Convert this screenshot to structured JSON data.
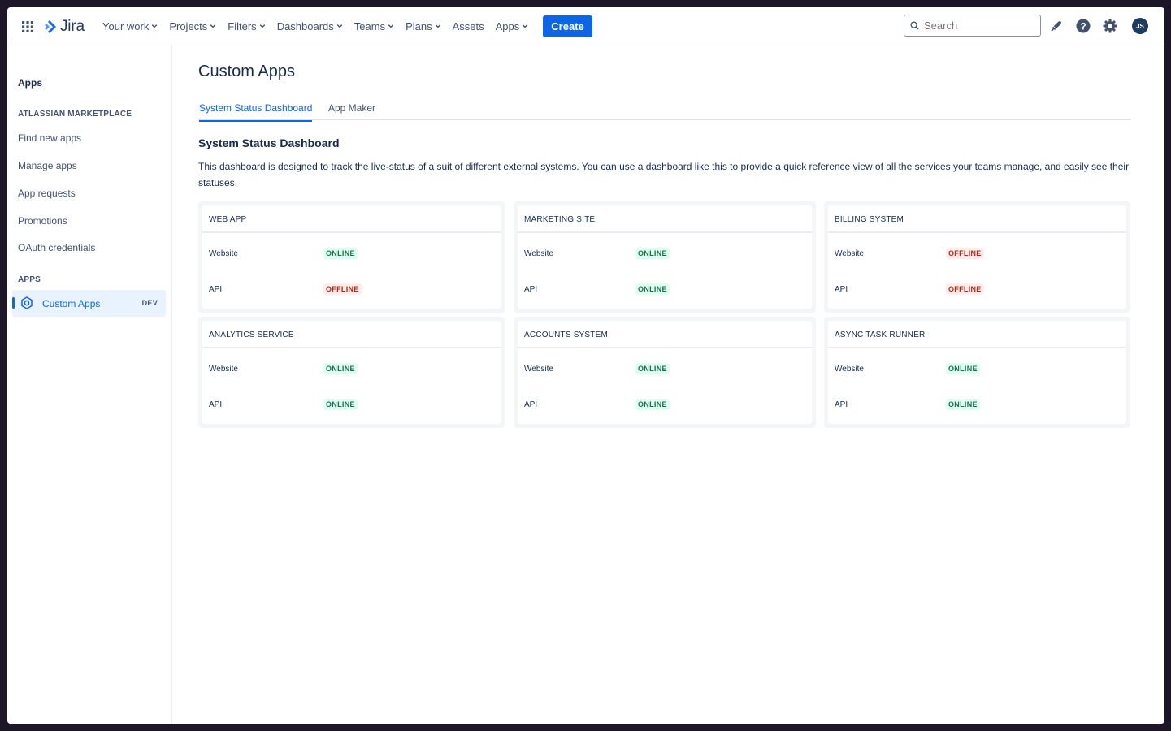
{
  "nav": {
    "logo": "Jira",
    "items": [
      {
        "label": "Your work",
        "chevron": true
      },
      {
        "label": "Projects",
        "chevron": true
      },
      {
        "label": "Filters",
        "chevron": true
      },
      {
        "label": "Dashboards",
        "chevron": true
      },
      {
        "label": "Teams",
        "chevron": true
      },
      {
        "label": "Plans",
        "chevron": true
      },
      {
        "label": "Assets",
        "chevron": false
      },
      {
        "label": "Apps",
        "chevron": true
      }
    ],
    "create_label": "Create",
    "search_placeholder": "Search",
    "avatar_initials": "JS",
    "accent": "#0c66e4"
  },
  "sidebar": {
    "title": "Apps",
    "marketplace_heading": "ATLASSIAN MARKETPLACE",
    "marketplace_links": [
      "Find new apps",
      "Manage apps",
      "App requests",
      "Promotions",
      "OAuth credentials"
    ],
    "apps_heading": "APPS",
    "active_app": {
      "label": "Custom Apps",
      "badge": "DEV"
    }
  },
  "main": {
    "title": "Custom Apps",
    "tabs": [
      {
        "label": "System Status Dashboard",
        "active": true
      },
      {
        "label": "App Maker",
        "active": false
      }
    ],
    "section_title": "System Status Dashboard",
    "description": "This dashboard is designed to track the live-status of a suit of different external systems. You can use a dashboard like this to provide a quick reference view of all the services your teams manage, and easily see their statuses."
  },
  "systems": [
    {
      "name": "WEB APP",
      "rows": [
        {
          "label": "Website",
          "status": "ONLINE"
        },
        {
          "label": "API",
          "status": "OFFLINE"
        }
      ]
    },
    {
      "name": "MARKETING SITE",
      "rows": [
        {
          "label": "Website",
          "status": "ONLINE"
        },
        {
          "label": "API",
          "status": "ONLINE"
        }
      ]
    },
    {
      "name": "BILLING SYSTEM",
      "rows": [
        {
          "label": "Website",
          "status": "OFFLINE"
        },
        {
          "label": "API",
          "status": "OFFLINE"
        }
      ]
    },
    {
      "name": "ANALYTICS SERVICE",
      "rows": [
        {
          "label": "Website",
          "status": "ONLINE"
        },
        {
          "label": "API",
          "status": "ONLINE"
        }
      ]
    },
    {
      "name": "ACCOUNTS SYSTEM",
      "rows": [
        {
          "label": "Website",
          "status": "ONLINE"
        },
        {
          "label": "API",
          "status": "ONLINE"
        }
      ]
    },
    {
      "name": "ASYNC TASK RUNNER",
      "rows": [
        {
          "label": "Website",
          "status": "ONLINE"
        },
        {
          "label": "API",
          "status": "ONLINE"
        }
      ]
    }
  ]
}
